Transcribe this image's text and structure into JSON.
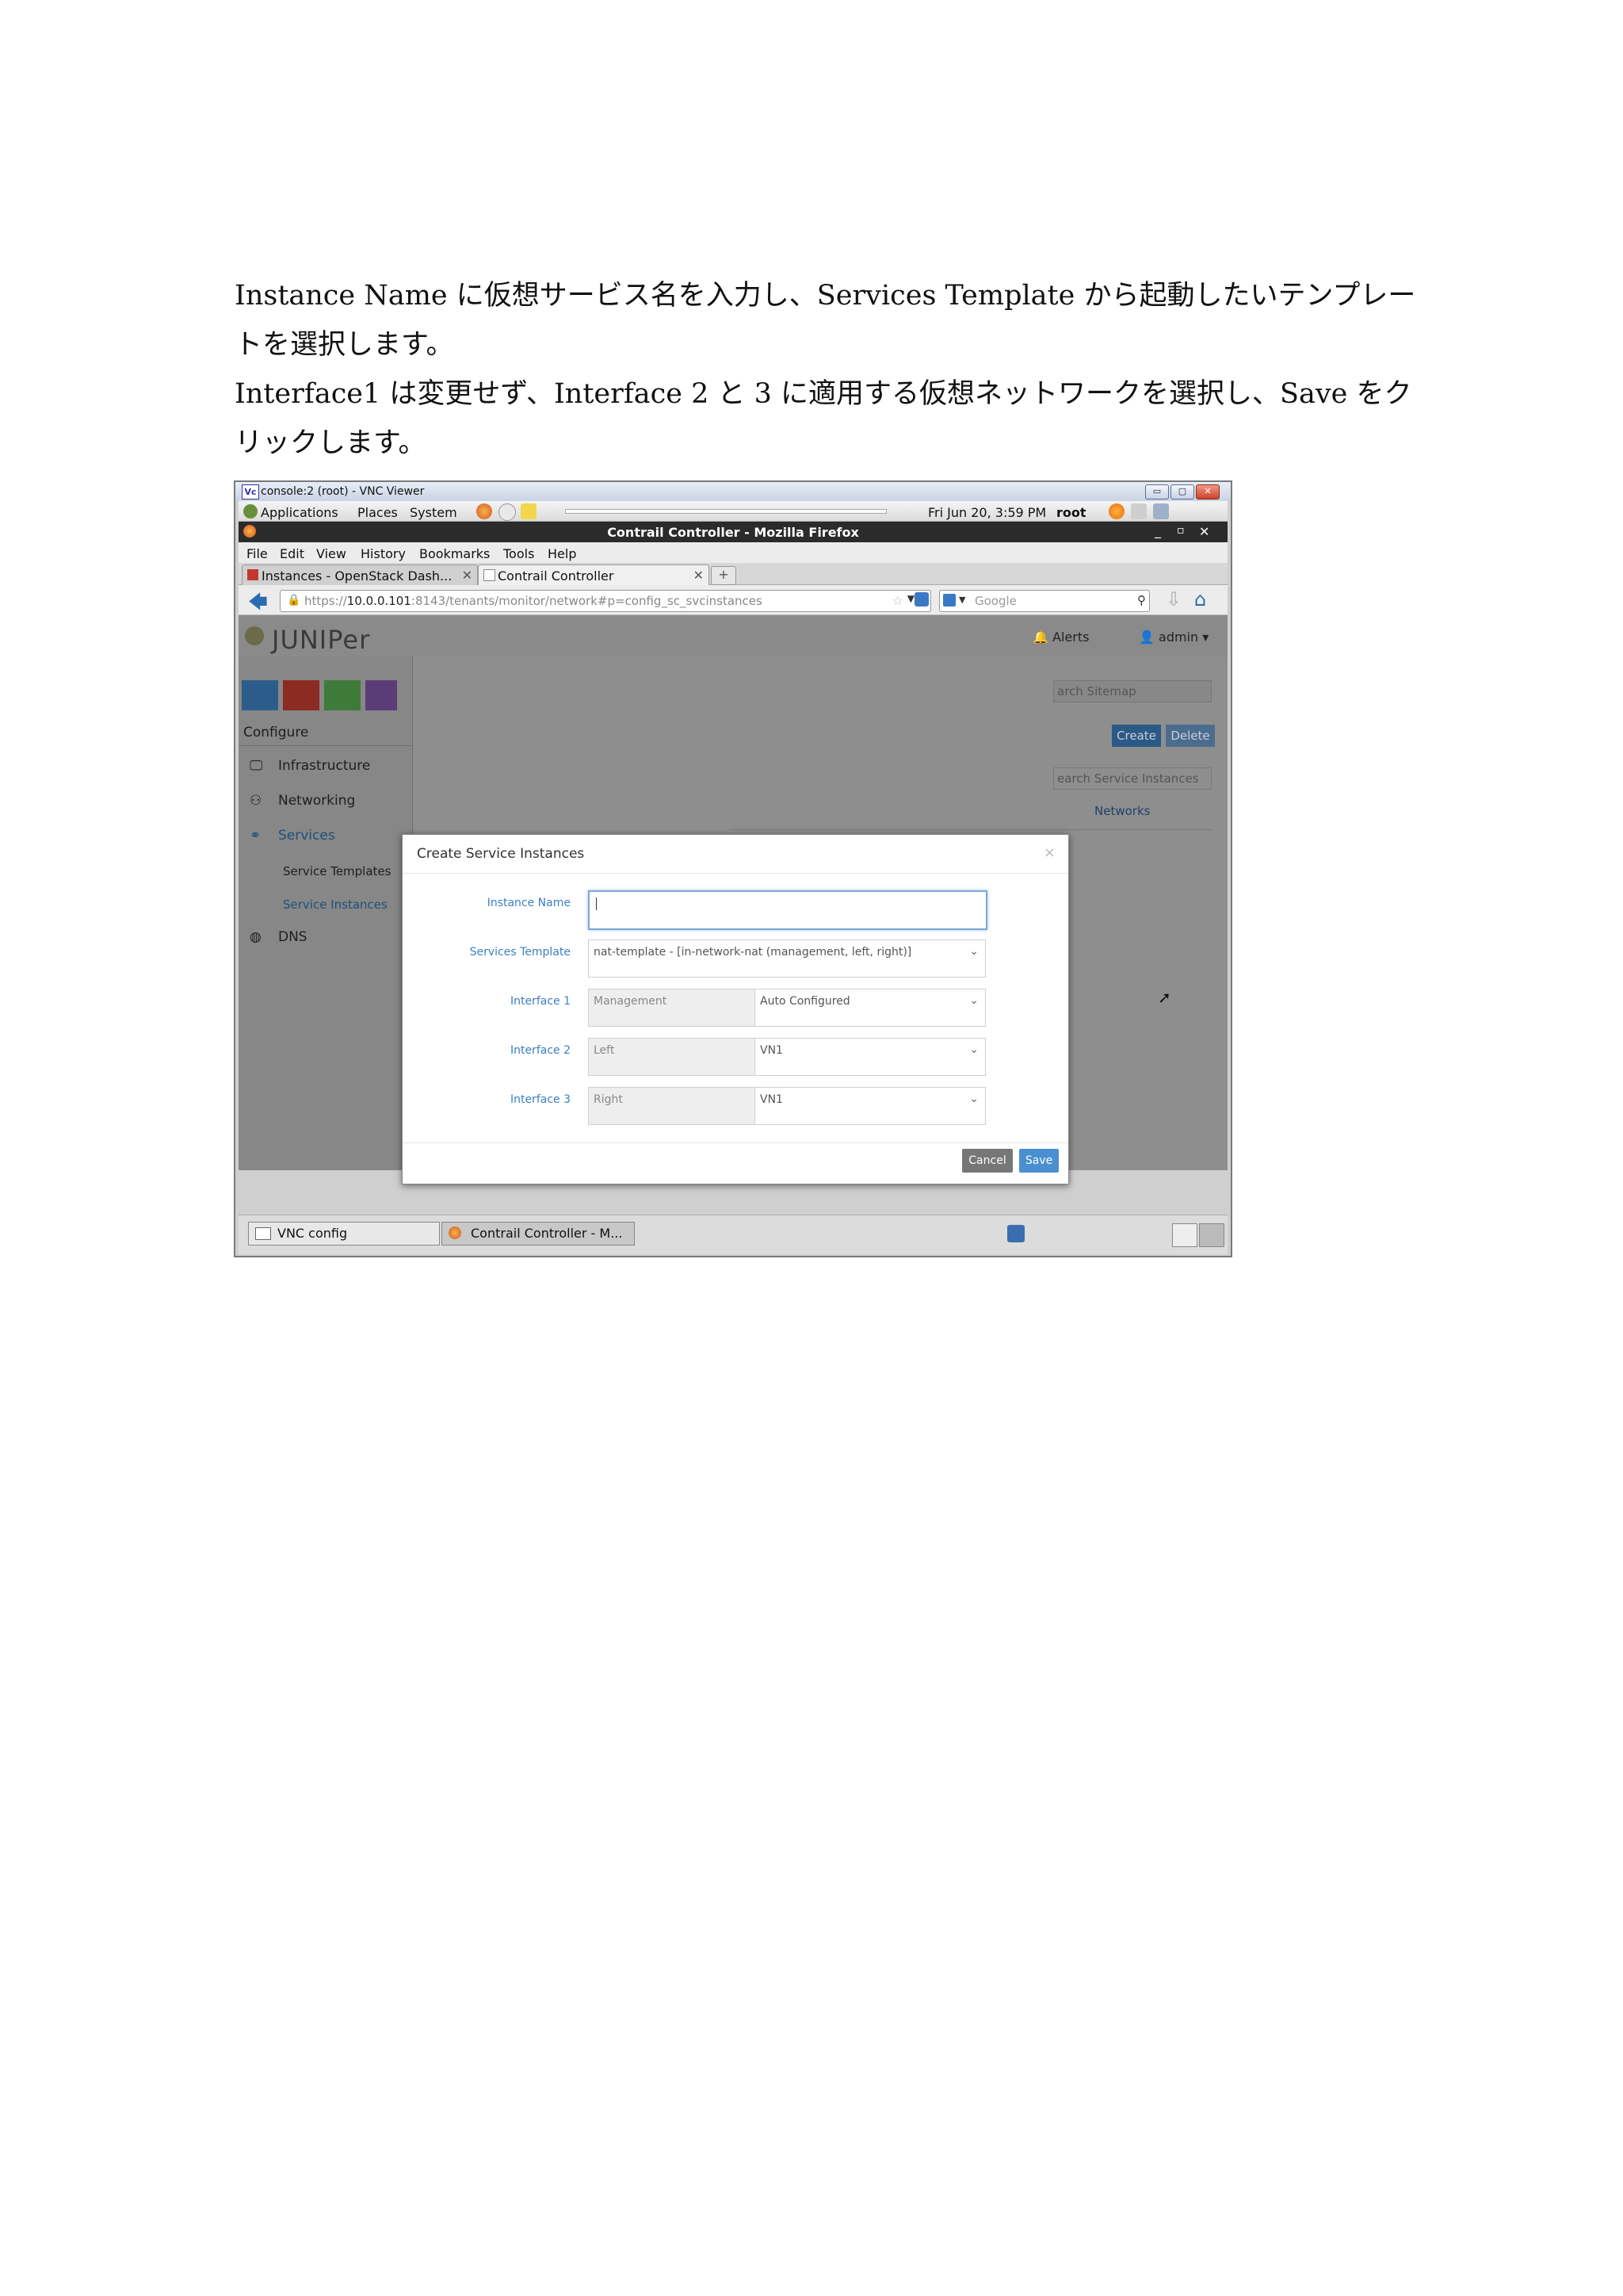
{
  "instructions": {
    "paragraph1": "Instance Name に仮想サービス名を入力し、Services Template から起動したいテンプレートを選択します。",
    "paragraph2": "Interface1 は変更せず、Interface 2 と 3 に適用する仮想ネットワークを選択し、Save をクリックします。"
  },
  "vnc": {
    "title": "console:2 (root) - VNC Viewer",
    "logo": "Vc"
  },
  "gnome_panel": {
    "menus": [
      "Applications",
      "Places",
      "System"
    ],
    "datetime": "Fri Jun 20,  3:59 PM",
    "user": "root"
  },
  "browser": {
    "title": "Contrail Controller - Mozilla Firefox",
    "menu": [
      "File",
      "Edit",
      "View",
      "History",
      "Bookmarks",
      "Tools",
      "Help"
    ],
    "tabs": [
      {
        "label": "Instances - OpenStack Dash..."
      },
      {
        "label": "Contrail Controller"
      }
    ],
    "url_prefix": "https://",
    "url_host": "10.0.0.101",
    "url_rest": ":8143/tenants/monitor/network#p=config_sc_svcinstances",
    "search_placeholder": "Google"
  },
  "app": {
    "logo": "JUNIPer",
    "alerts": "Alerts",
    "user": "admin",
    "sidebar_title": "Configure",
    "nav": [
      {
        "label": "Infrastructure"
      },
      {
        "label": "Networking"
      },
      {
        "label": "Services"
      },
      {
        "label": "Service Templates"
      },
      {
        "label": "Service Instances"
      },
      {
        "label": "DNS"
      }
    ],
    "search_sitemap": "arch Sitemap",
    "create_label": "Create",
    "delete_label": "Delete",
    "search_instances": "earch Service Instances",
    "networks_col": "Networks"
  },
  "modal": {
    "title": "Create Service Instances",
    "close": "×",
    "instance_name_label": "Instance Name",
    "instance_name_value": "",
    "template_label": "Services Template",
    "template_value": "nat-template - [in-network-nat (management, left, right)]",
    "interfaces": [
      {
        "label": "Interface 1",
        "type": "Management",
        "network": "Auto Configured"
      },
      {
        "label": "Interface 2",
        "type": "Left",
        "network": "VN1"
      },
      {
        "label": "Interface 3",
        "type": "Right",
        "network": "VN1"
      }
    ],
    "cancel_label": "Cancel",
    "save_label": "Save"
  },
  "taskbar": {
    "items": [
      {
        "label": "VNC config"
      },
      {
        "label": "Contrail Controller - M..."
      }
    ]
  }
}
